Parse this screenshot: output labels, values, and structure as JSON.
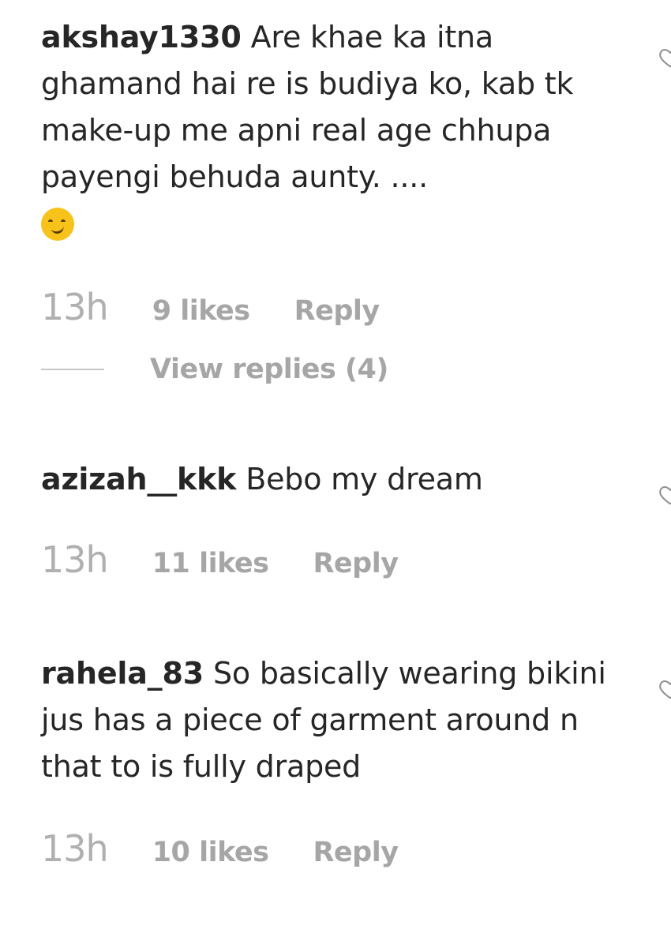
{
  "comments": [
    {
      "username": "akshay1330",
      "text": "Are khae ka itna ghamand hai re is budiya ko, kab tk make-up me apni real age chhupa payengi behuda aunty. ....",
      "emoji": "smirk-emoji",
      "time": "13h",
      "likes": "9 likes",
      "reply": "Reply",
      "view_replies": "View replies (4)"
    },
    {
      "username": "azizah__kkk",
      "text": "Bebo my dream",
      "time": "13h",
      "likes": "11 likes",
      "reply": "Reply"
    },
    {
      "username": "rahela_83",
      "text": "So basically wearing bikini jus has a piece of garment around n that to is fully draped",
      "time": "13h",
      "likes": "10 likes",
      "reply": "Reply"
    }
  ],
  "icons": {
    "like": "heart-outline-icon"
  },
  "colors": {
    "text": "#262626",
    "secondary": "#a6a6a6"
  }
}
